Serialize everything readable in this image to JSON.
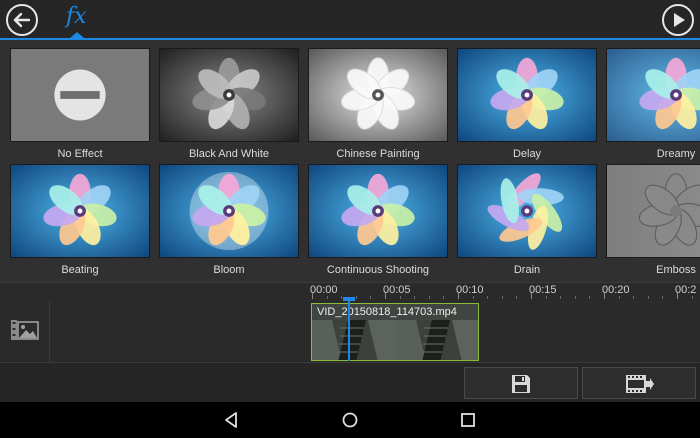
{
  "toolbar": {
    "back_icon": "back-arrow-icon",
    "fx_tab_label": "fx",
    "play_icon": "play-icon",
    "accent_color": "#1e88e5"
  },
  "effects": [
    {
      "label": "No Effect",
      "style": "none"
    },
    {
      "label": "Black And White",
      "style": "bw"
    },
    {
      "label": "Chinese Painting",
      "style": "chinese"
    },
    {
      "label": "Delay",
      "style": "color"
    },
    {
      "label": "Dreamy",
      "style": "dreamy"
    },
    {
      "label": "Beating",
      "style": "color"
    },
    {
      "label": "Bloom",
      "style": "bloom"
    },
    {
      "label": "Continuous Shooting",
      "style": "color"
    },
    {
      "label": "Drain",
      "style": "drain"
    },
    {
      "label": "Emboss",
      "style": "emboss"
    }
  ],
  "timeline": {
    "track_icon": "media-track-icon",
    "ruler_labels": [
      "00:00",
      "00:05",
      "00:10",
      "00:15",
      "00:20",
      "00:2"
    ],
    "clip_name": "VID_20150818_114703.mp4",
    "clip_border_color": "#8bbb3a"
  },
  "actions": {
    "save_icon": "save-icon",
    "produce_icon": "produce-video-icon"
  },
  "navbar": {
    "back_icon": "nav-back-icon",
    "home_icon": "nav-home-icon",
    "recent_icon": "nav-recent-apps-icon"
  }
}
